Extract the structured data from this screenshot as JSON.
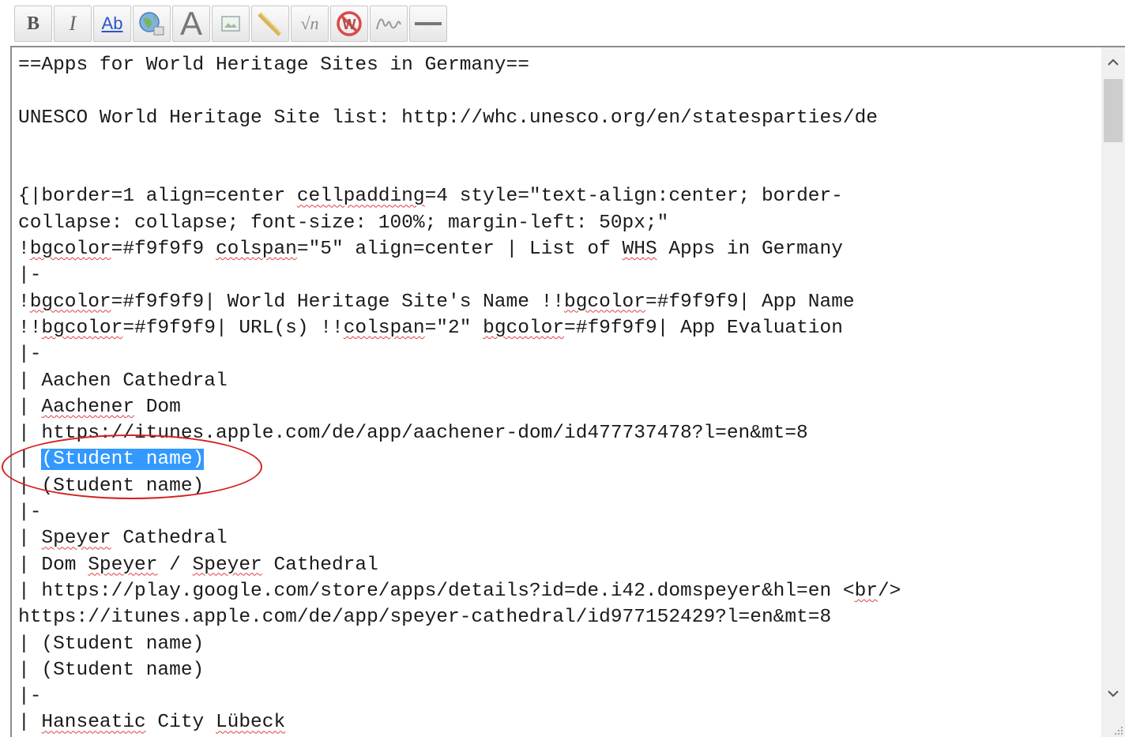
{
  "toolbar": {
    "buttons": [
      {
        "name": "bold-button",
        "label": "B",
        "icon": "bold-icon"
      },
      {
        "name": "italic-button",
        "label": "I",
        "icon": "italic-icon"
      },
      {
        "name": "internal-link-button",
        "label": "Ab",
        "icon": "internal-link-icon"
      },
      {
        "name": "external-link-button",
        "label": "",
        "icon": "globe-link-icon"
      },
      {
        "name": "headline-button",
        "label": "A",
        "icon": "headline-icon"
      },
      {
        "name": "embedded-file-button",
        "label": "",
        "icon": "image-icon"
      },
      {
        "name": "media-file-button",
        "label": "",
        "icon": "media-icon"
      },
      {
        "name": "math-formula-button",
        "label": "√n",
        "icon": "math-icon"
      },
      {
        "name": "nowiki-button",
        "label": "W",
        "icon": "nowiki-icon"
      },
      {
        "name": "signature-button",
        "label": "",
        "icon": "signature-icon"
      },
      {
        "name": "horizontal-line-button",
        "label": "",
        "icon": "horizontal-line-icon"
      }
    ]
  },
  "editor": {
    "lines": [
      "==Apps for World Heritage Sites in Germany==",
      "",
      "UNESCO World Heritage Site list: http://whc.unesco.org/en/statesparties/de",
      "",
      "",
      "{|border=1 align=center cellpadding=4 style=\"text-align:center; border-",
      "collapse: collapse; font-size: 100%; margin-left: 50px;\"",
      "!bgcolor=#f9f9f9 colspan=\"5\" align=center | List of WHS Apps in Germany",
      "|-",
      "!bgcolor=#f9f9f9| World Heritage Site's Name !!bgcolor=#f9f9f9| App Name",
      "!!bgcolor=#f9f9f9| URL(s) !!colspan=\"2\" bgcolor=#f9f9f9| App Evaluation",
      "|-",
      "| Aachen Cathedral",
      "| Aachener Dom",
      "| https://itunes.apple.com/de/app/aachener-dom/id477737478?l=en&mt=8",
      "| (Student name)",
      "| (Student name)",
      "|-",
      "| Speyer Cathedral",
      "| Dom Speyer / Speyer Cathedral",
      "| https://play.google.com/store/apps/details?id=de.i42.domspeyer&hl=en <br/>",
      "https://itunes.apple.com/de/app/speyer-cathedral/id977152429?l=en&mt=8",
      "| (Student name)",
      "| (Student name)",
      "|-",
      "| Hanseatic City Lübeck"
    ],
    "misspelled": [
      "cellpadding",
      "bgcolor",
      "colspan",
      "WHS",
      "Aachener",
      "Speyer",
      "Hanseatic",
      "Lübeck",
      "br"
    ],
    "selected_text": "(Student name)",
    "selected_line_index": 15
  },
  "scrollbar": {
    "up_arrow": "chevron-up-icon",
    "down_arrow": "chevron-down-icon",
    "position": 0.04
  },
  "colors": {
    "selection": "#3399ff",
    "annotation": "#d52020",
    "spellcheck": "#e04040"
  }
}
